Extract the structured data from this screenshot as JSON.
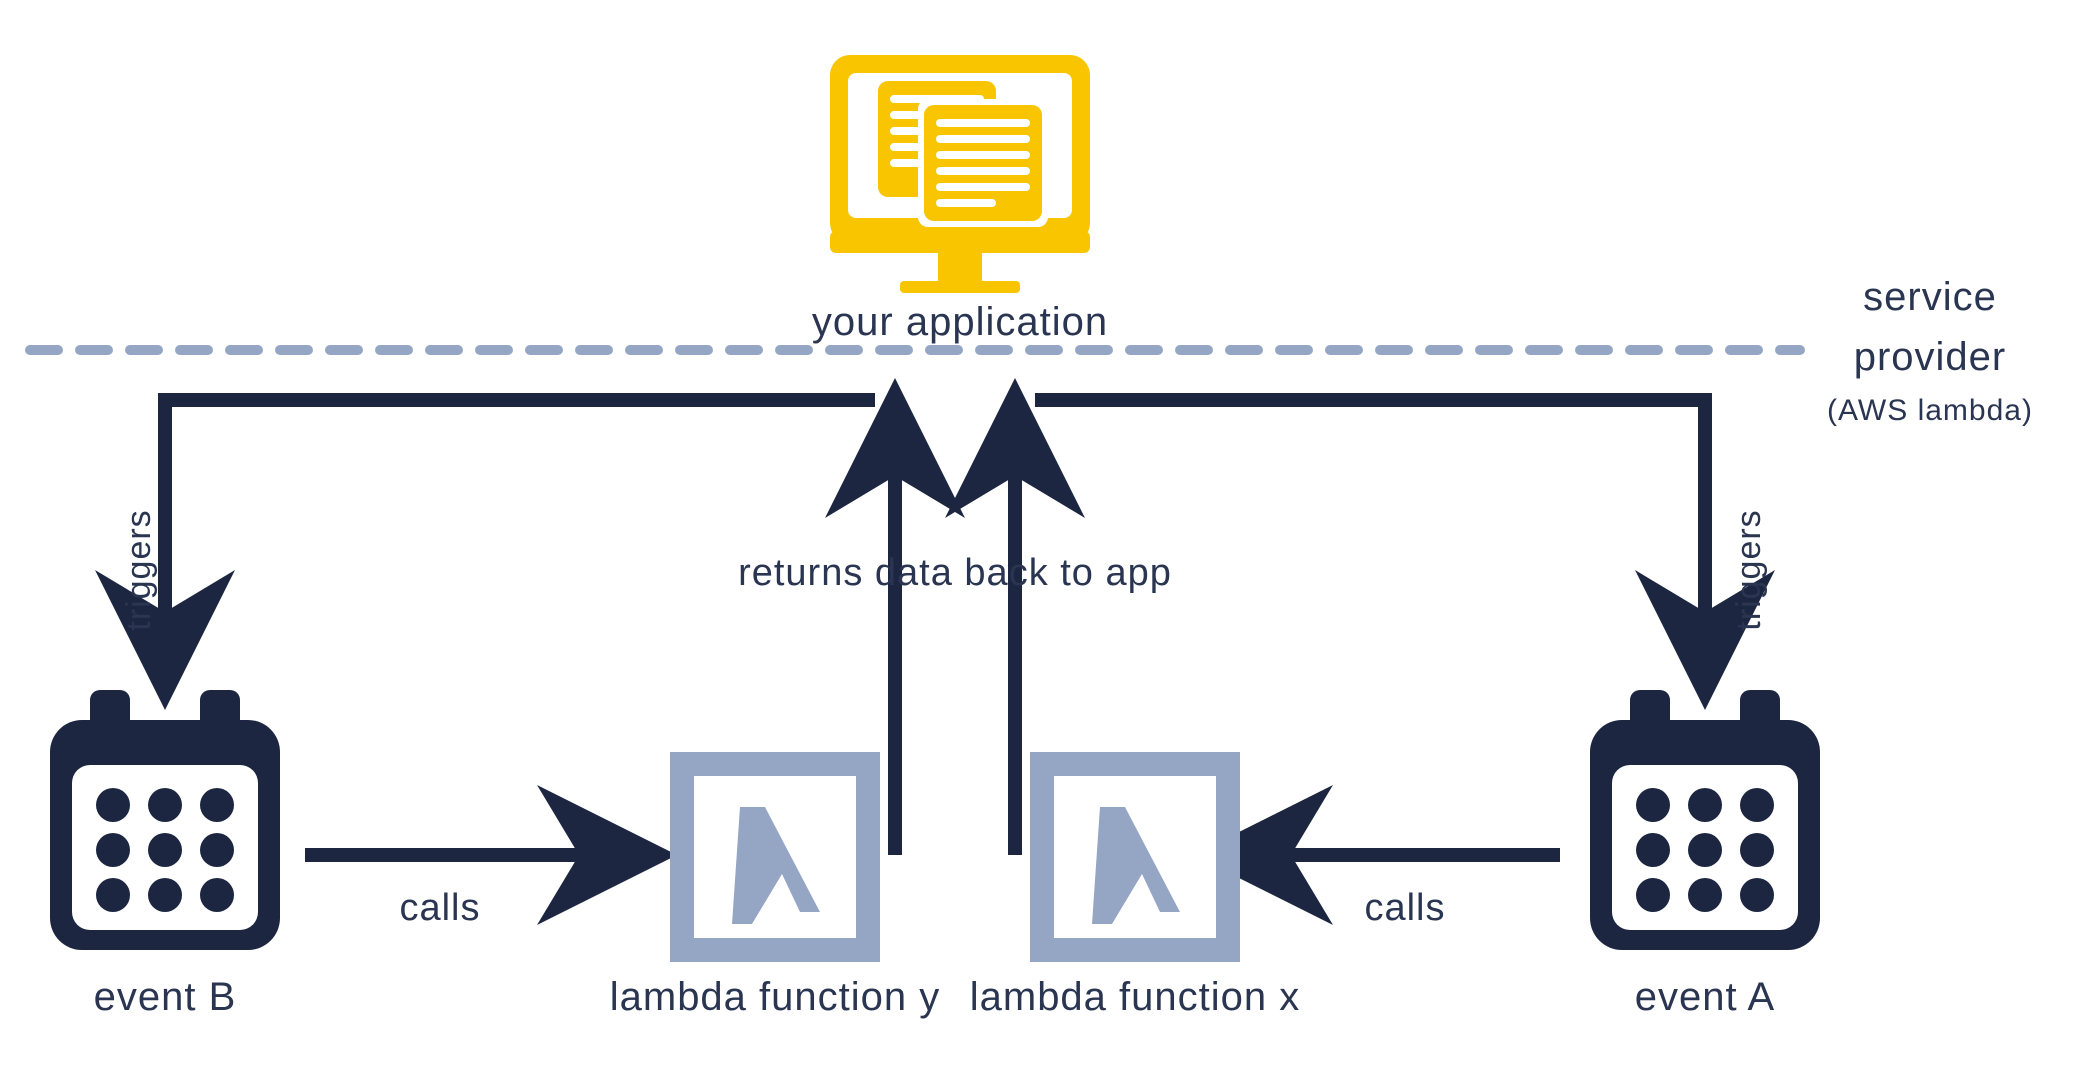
{
  "colors": {
    "dark": "#1c2640",
    "blue": "#95a6c5",
    "yellow": "#f9c500",
    "text": "#2a3551"
  },
  "app": {
    "label": "your application"
  },
  "divider": {
    "right_top": "service",
    "right_bottom": "provider",
    "right_sub": "(AWS lambda)"
  },
  "arrows": {
    "left_trigger": "triggers",
    "right_trigger": "triggers",
    "left_calls": "calls",
    "right_calls": "calls",
    "returns": "returns data back to app"
  },
  "nodes": {
    "event_b": "event B",
    "event_a": "event A",
    "lambda_y": "lambda function y",
    "lambda_x": "lambda function x"
  }
}
